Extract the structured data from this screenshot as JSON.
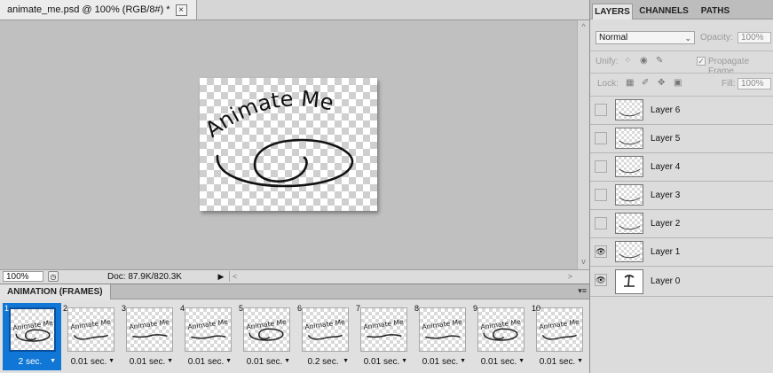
{
  "document": {
    "tab_title": "animate_me.psd @ 100% (RGB/8#) *",
    "close_glyph": "×",
    "canvas_text": "Animate Me",
    "zoom_value": "100%",
    "doc_size": "Doc: 87.9K/820.3K"
  },
  "animation": {
    "panel_title": "ANIMATION (FRAMES)",
    "frames": [
      {
        "number": "1",
        "delay": "2 sec.",
        "selected": true
      },
      {
        "number": "2",
        "delay": "0.01 sec.",
        "selected": false
      },
      {
        "number": "3",
        "delay": "0.01 sec.",
        "selected": false
      },
      {
        "number": "4",
        "delay": "0.01 sec.",
        "selected": false
      },
      {
        "number": "5",
        "delay": "0.01 sec.",
        "selected": false
      },
      {
        "number": "6",
        "delay": "0.2 sec.",
        "selected": false
      },
      {
        "number": "7",
        "delay": "0.01 sec.",
        "selected": false
      },
      {
        "number": "8",
        "delay": "0.01 sec.",
        "selected": false
      },
      {
        "number": "9",
        "delay": "0.01 sec.",
        "selected": false
      },
      {
        "number": "10",
        "delay": "0.01 sec.",
        "selected": false
      }
    ],
    "thumb_text": "Animate Me"
  },
  "layers_panel": {
    "tabs": [
      "LAYERS",
      "CHANNELS",
      "PATHS"
    ],
    "blend_mode": "Normal",
    "opacity_label": "Opacity:",
    "opacity_value": "100%",
    "unify_label": "Unify:",
    "propagate_label": "Propagate Frame",
    "lock_label": "Lock:",
    "fill_label": "Fill:",
    "fill_value": "100%",
    "layers": [
      {
        "name": "Layer 6",
        "visible": false
      },
      {
        "name": "Layer 5",
        "visible": false
      },
      {
        "name": "Layer 4",
        "visible": false
      },
      {
        "name": "Layer 3",
        "visible": false
      },
      {
        "name": "Layer 2",
        "visible": false
      },
      {
        "name": "Layer 1",
        "visible": true
      },
      {
        "name": "Layer 0",
        "visible": true
      }
    ]
  },
  "colors": {
    "selection_blue": "#1177d6",
    "panel_gray": "#dcdcdc",
    "canvas_gray": "#c0c0c0"
  }
}
